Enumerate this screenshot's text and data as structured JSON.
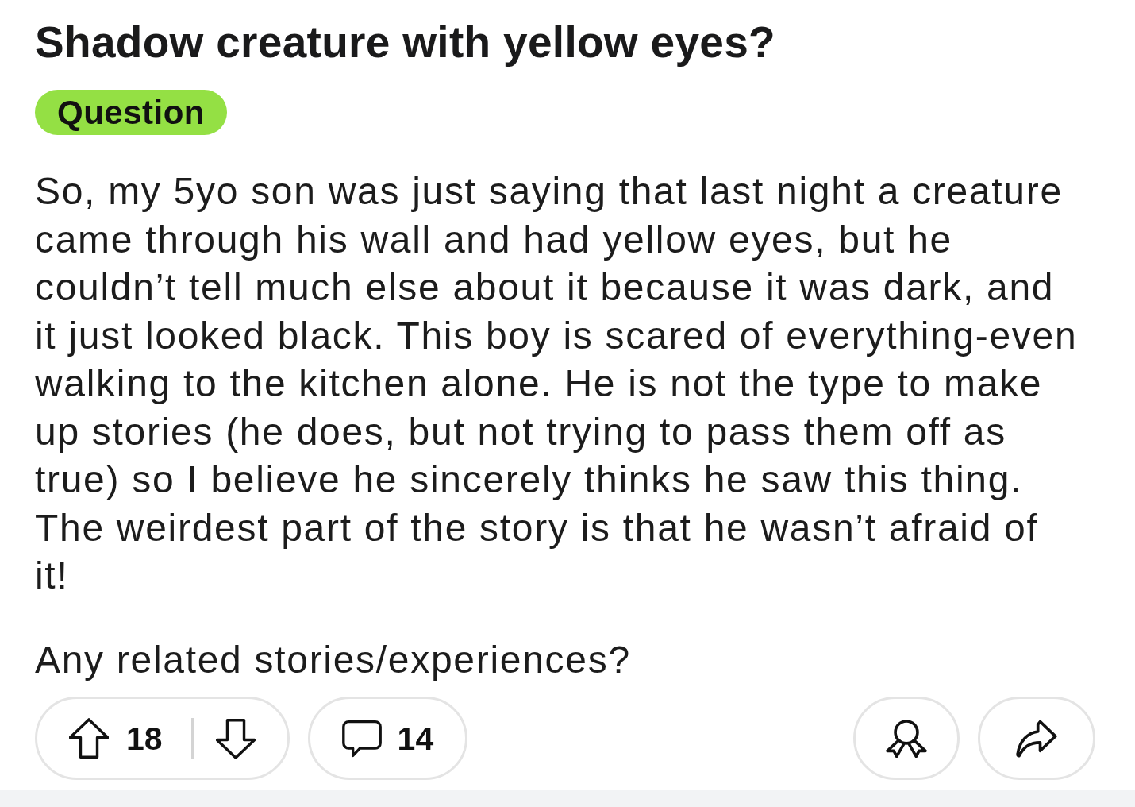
{
  "post": {
    "title": "Shadow creature with yellow eyes?",
    "flair": "Question",
    "body": [
      "So, my 5yo son was just saying that last night a creature came through his wall and had yellow eyes, but he couldn’t tell much else about it because it was dark, and it just looked black. This boy is scared of everything-even walking to the kitchen alone. He is not the type to make up stories (he does, but not trying to pass them off as true) so I believe he sincerely thinks he saw this thing. The weirdest part of the story is that he wasn’t afraid of it!",
      "Any related stories/experiences?"
    ]
  },
  "actions": {
    "upvotes": "18",
    "comments": "14"
  }
}
